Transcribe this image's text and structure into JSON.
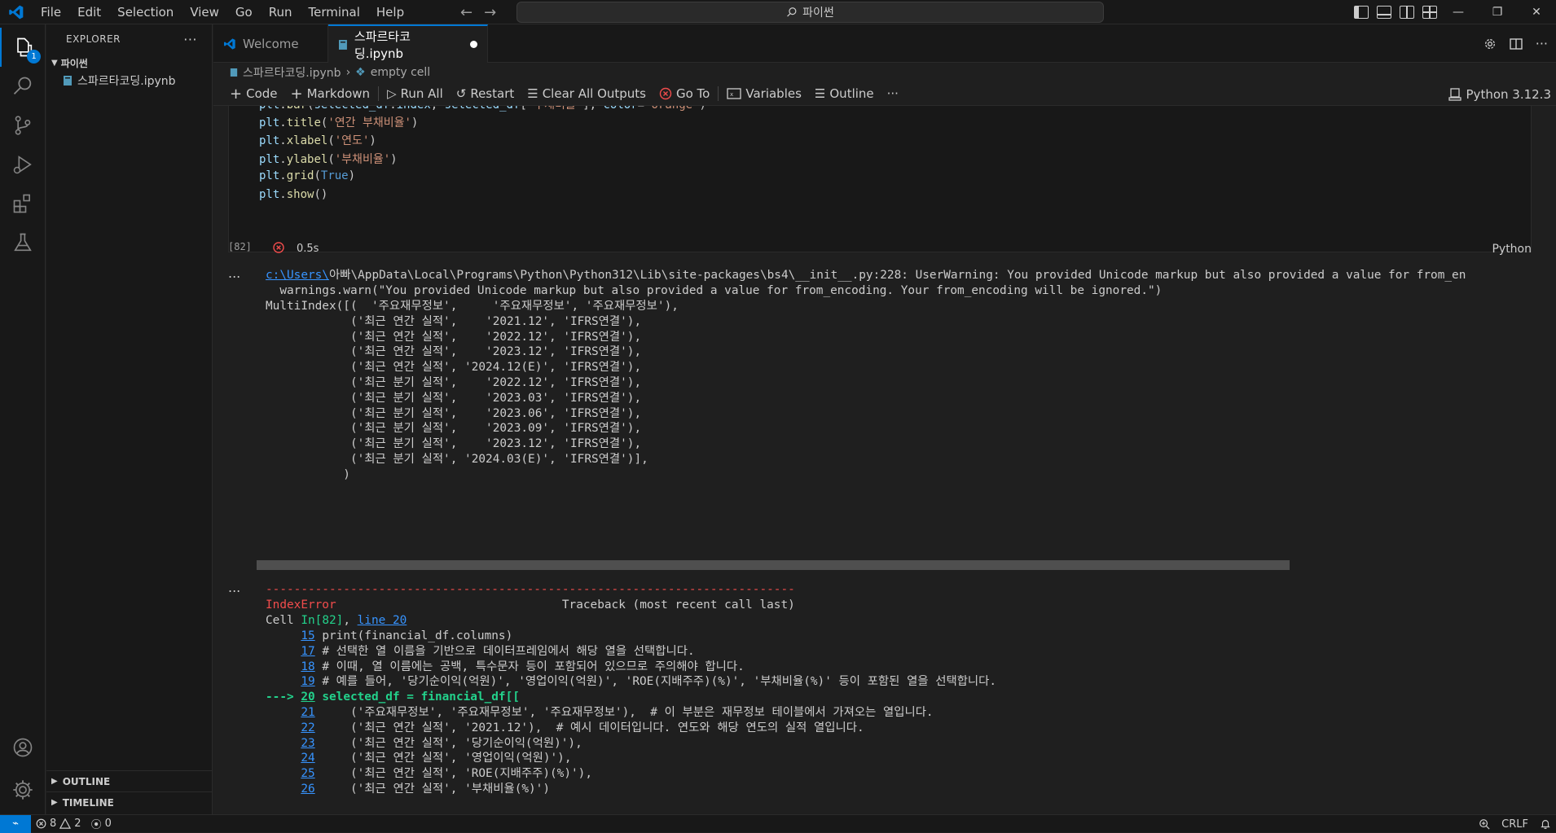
{
  "menu": [
    "File",
    "Edit",
    "Selection",
    "View",
    "Go",
    "Run",
    "Terminal",
    "Help"
  ],
  "search": {
    "text": "파이썬"
  },
  "activity": {
    "explorer_badge": "1"
  },
  "sidebar": {
    "title": "EXPLORER",
    "folder": "파이썬",
    "file": "스파르타코딩.ipynb",
    "outline": "OUTLINE",
    "timeline": "TIMELINE"
  },
  "tabs": [
    {
      "label": "Welcome"
    },
    {
      "label": "스파르타코딩.ipynb"
    }
  ],
  "breadcrumb": {
    "file": "스파르타코딩.ipynb",
    "cell": "empty cell"
  },
  "toolbar": {
    "code": "Code",
    "markdown": "Markdown",
    "run_all": "Run All",
    "restart": "Restart",
    "clear_all": "Clear All Outputs",
    "goto": "Go To",
    "variables": "Variables",
    "outline": "Outline",
    "more": "···",
    "kernel": "Python 3.12.3"
  },
  "cell": {
    "lines": [
      "plt.bar(selected_df.index, selected_df['부채비율'], color='orange')",
      "plt.title('연간 부채비율')",
      "plt.xlabel('연도')",
      "plt.ylabel('부채비율')",
      "plt.grid(True)",
      "plt.show()"
    ],
    "exec_count": "[82]",
    "duration": "0.5s",
    "language": "Python"
  },
  "output1": {
    "ellipsis": "...",
    "warning_path_link": "c:\\Users\\",
    "warning_rest": "아빠\\AppData\\Local\\Programs\\Python\\Python312\\Lib\\site-packages\\bs4\\__init__.py:228: UserWarning: You provided Unicode markup but also provided a value for from_en",
    "warnings_line": "  warnings.warn(\"You provided Unicode markup but also provided a value for from_encoding. Your from_encoding will be ignored.\")",
    "multiindex": [
      "MultiIndex([(  '주요재무정보',     '주요재무정보', '주요재무정보'),",
      "            ('최근 연간 실적',    '2021.12', 'IFRS연결'),",
      "            ('최근 연간 실적',    '2022.12', 'IFRS연결'),",
      "            ('최근 연간 실적',    '2023.12', 'IFRS연결'),",
      "            ('최근 연간 실적', '2024.12(E)', 'IFRS연결'),",
      "            ('최근 분기 실적',    '2022.12', 'IFRS연결'),",
      "            ('최근 분기 실적',    '2023.03', 'IFRS연결'),",
      "            ('최근 분기 실적',    '2023.06', 'IFRS연결'),",
      "            ('최근 분기 실적',    '2023.09', 'IFRS연결'),",
      "            ('최근 분기 실적',    '2023.12', 'IFRS연결'),",
      "            ('최근 분기 실적', '2024.03(E)', 'IFRS연결')],",
      "           )"
    ]
  },
  "output2": {
    "ellipsis": "...",
    "dashes": "---------------------------------------------------------------------------",
    "error_name": "IndexError",
    "traceback_label": "                                Traceback (most recent call last)",
    "cell_prefix": "Cell ",
    "cell_ref": "In[82]",
    "cell_sep": ", ",
    "line_ref": "line 20",
    "arrow": "---> ",
    "lines": [
      {
        "num": "15",
        "code": "print(financial_df.columns)"
      },
      {
        "num": "17",
        "code": "# 선택한 열 이름을 기반으로 데이터프레임에서 해당 열을 선택합니다."
      },
      {
        "num": "18",
        "code": "# 이때, 열 이름에는 공백, 특수문자 등이 포함되어 있으므로 주의해야 합니다."
      },
      {
        "num": "19",
        "code": "# 예를 들어, '당기순이익(억원)', '영업이익(억원)', 'ROE(지배주주)(%)', '부채비율(%)' 등이 포함된 열을 선택합니다."
      },
      {
        "num": "20",
        "code": "selected_df = financial_df[["
      },
      {
        "num": "21",
        "code": "    ('주요재무정보', '주요재무정보', '주요재무정보'),  # 이 부분은 재무정보 테이블에서 가져오는 열입니다."
      },
      {
        "num": "22",
        "code": "    ('최근 연간 실적', '2021.12'),  # 예시 데이터입니다. 연도와 해당 연도의 실적 열입니다."
      },
      {
        "num": "23",
        "code": "    ('최근 연간 실적', '당기순이익(억원)'),"
      },
      {
        "num": "24",
        "code": "    ('최근 연간 실적', '영업이익(억원)'),"
      },
      {
        "num": "25",
        "code": "    ('최근 연간 실적', 'ROE(지배주주)(%)'),"
      },
      {
        "num": "26",
        "code": "    ('최근 연간 실적', '부채비율(%)')"
      }
    ]
  },
  "status": {
    "errors": "8",
    "warnings": "2",
    "ports": "0",
    "eol": "CRLF"
  }
}
